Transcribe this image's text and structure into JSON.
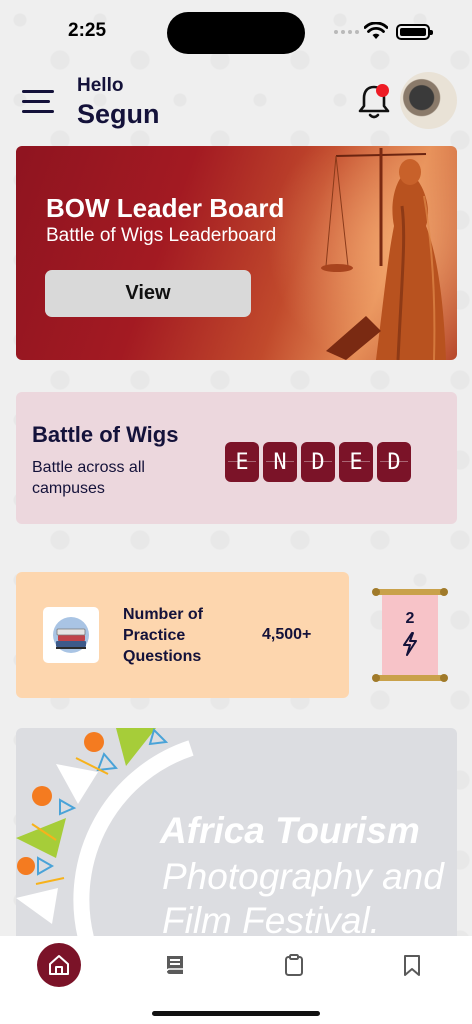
{
  "status_bar": {
    "time": "2:25"
  },
  "header": {
    "greeting": "Hello",
    "user_name": "Segun"
  },
  "leaderboard_banner": {
    "title": "BOW Leader Board",
    "subtitle": "Battle of Wigs Leaderboard",
    "button_label": "View"
  },
  "battle_of_wigs": {
    "title": "Battle of Wigs",
    "description": "Battle across all campuses",
    "status_tiles": [
      "E",
      "N",
      "D",
      "E",
      "D"
    ]
  },
  "practice_questions": {
    "label": "Number of Practice Questions",
    "count": "4,500+"
  },
  "streak_badge": {
    "count": "2"
  },
  "promo_banner": {
    "title": "Africa Tourism",
    "subtitle_line1": "Photography and",
    "subtitle_line2": "Film Festival."
  },
  "bottom_nav": {
    "items": [
      "home-icon",
      "book-icon",
      "clipboard-icon",
      "bookmark-icon"
    ],
    "active": "home-icon"
  },
  "colors": {
    "brand_maroon": "#7b1328",
    "navy_text": "#14123a",
    "notification_red": "#ee1c25",
    "practice_card": "#fdd6ae",
    "wigs_card": "#ecd7dd",
    "streak_badge": "#f7c3c8"
  }
}
